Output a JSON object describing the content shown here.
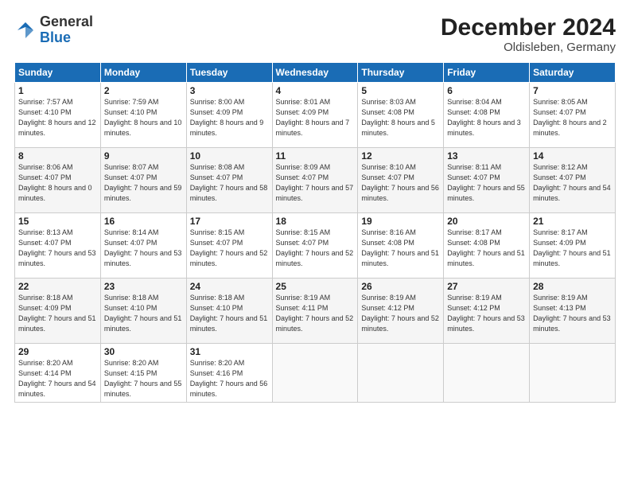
{
  "header": {
    "logo_general": "General",
    "logo_blue": "Blue",
    "month_title": "December 2024",
    "location": "Oldisleben, Germany"
  },
  "days_of_week": [
    "Sunday",
    "Monday",
    "Tuesday",
    "Wednesday",
    "Thursday",
    "Friday",
    "Saturday"
  ],
  "weeks": [
    [
      {
        "day": 1,
        "sunrise": "7:57 AM",
        "sunset": "4:10 PM",
        "daylight": "8 hours and 12 minutes."
      },
      {
        "day": 2,
        "sunrise": "7:59 AM",
        "sunset": "4:10 PM",
        "daylight": "8 hours and 10 minutes."
      },
      {
        "day": 3,
        "sunrise": "8:00 AM",
        "sunset": "4:09 PM",
        "daylight": "8 hours and 9 minutes."
      },
      {
        "day": 4,
        "sunrise": "8:01 AM",
        "sunset": "4:09 PM",
        "daylight": "8 hours and 7 minutes."
      },
      {
        "day": 5,
        "sunrise": "8:03 AM",
        "sunset": "4:08 PM",
        "daylight": "8 hours and 5 minutes."
      },
      {
        "day": 6,
        "sunrise": "8:04 AM",
        "sunset": "4:08 PM",
        "daylight": "8 hours and 3 minutes."
      },
      {
        "day": 7,
        "sunrise": "8:05 AM",
        "sunset": "4:07 PM",
        "daylight": "8 hours and 2 minutes."
      }
    ],
    [
      {
        "day": 8,
        "sunrise": "8:06 AM",
        "sunset": "4:07 PM",
        "daylight": "8 hours and 0 minutes."
      },
      {
        "day": 9,
        "sunrise": "8:07 AM",
        "sunset": "4:07 PM",
        "daylight": "7 hours and 59 minutes."
      },
      {
        "day": 10,
        "sunrise": "8:08 AM",
        "sunset": "4:07 PM",
        "daylight": "7 hours and 58 minutes."
      },
      {
        "day": 11,
        "sunrise": "8:09 AM",
        "sunset": "4:07 PM",
        "daylight": "7 hours and 57 minutes."
      },
      {
        "day": 12,
        "sunrise": "8:10 AM",
        "sunset": "4:07 PM",
        "daylight": "7 hours and 56 minutes."
      },
      {
        "day": 13,
        "sunrise": "8:11 AM",
        "sunset": "4:07 PM",
        "daylight": "7 hours and 55 minutes."
      },
      {
        "day": 14,
        "sunrise": "8:12 AM",
        "sunset": "4:07 PM",
        "daylight": "7 hours and 54 minutes."
      }
    ],
    [
      {
        "day": 15,
        "sunrise": "8:13 AM",
        "sunset": "4:07 PM",
        "daylight": "7 hours and 53 minutes."
      },
      {
        "day": 16,
        "sunrise": "8:14 AM",
        "sunset": "4:07 PM",
        "daylight": "7 hours and 53 minutes."
      },
      {
        "day": 17,
        "sunrise": "8:15 AM",
        "sunset": "4:07 PM",
        "daylight": "7 hours and 52 minutes."
      },
      {
        "day": 18,
        "sunrise": "8:15 AM",
        "sunset": "4:07 PM",
        "daylight": "7 hours and 52 minutes."
      },
      {
        "day": 19,
        "sunrise": "8:16 AM",
        "sunset": "4:08 PM",
        "daylight": "7 hours and 51 minutes."
      },
      {
        "day": 20,
        "sunrise": "8:17 AM",
        "sunset": "4:08 PM",
        "daylight": "7 hours and 51 minutes."
      },
      {
        "day": 21,
        "sunrise": "8:17 AM",
        "sunset": "4:09 PM",
        "daylight": "7 hours and 51 minutes."
      }
    ],
    [
      {
        "day": 22,
        "sunrise": "8:18 AM",
        "sunset": "4:09 PM",
        "daylight": "7 hours and 51 minutes."
      },
      {
        "day": 23,
        "sunrise": "8:18 AM",
        "sunset": "4:10 PM",
        "daylight": "7 hours and 51 minutes."
      },
      {
        "day": 24,
        "sunrise": "8:18 AM",
        "sunset": "4:10 PM",
        "daylight": "7 hours and 51 minutes."
      },
      {
        "day": 25,
        "sunrise": "8:19 AM",
        "sunset": "4:11 PM",
        "daylight": "7 hours and 52 minutes."
      },
      {
        "day": 26,
        "sunrise": "8:19 AM",
        "sunset": "4:12 PM",
        "daylight": "7 hours and 52 minutes."
      },
      {
        "day": 27,
        "sunrise": "8:19 AM",
        "sunset": "4:12 PM",
        "daylight": "7 hours and 53 minutes."
      },
      {
        "day": 28,
        "sunrise": "8:19 AM",
        "sunset": "4:13 PM",
        "daylight": "7 hours and 53 minutes."
      }
    ],
    [
      {
        "day": 29,
        "sunrise": "8:20 AM",
        "sunset": "4:14 PM",
        "daylight": "7 hours and 54 minutes."
      },
      {
        "day": 30,
        "sunrise": "8:20 AM",
        "sunset": "4:15 PM",
        "daylight": "7 hours and 55 minutes."
      },
      {
        "day": 31,
        "sunrise": "8:20 AM",
        "sunset": "4:16 PM",
        "daylight": "7 hours and 56 minutes."
      },
      null,
      null,
      null,
      null
    ]
  ]
}
